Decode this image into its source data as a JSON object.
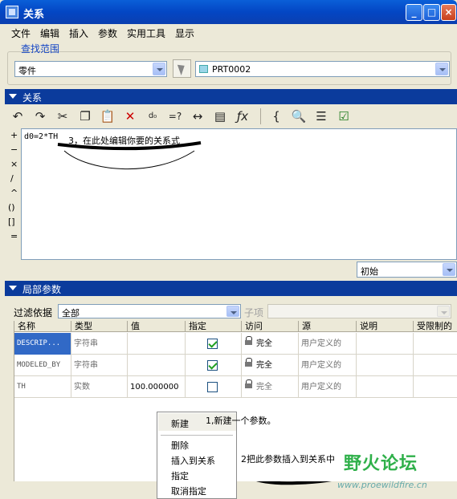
{
  "window": {
    "title": "关系",
    "minimize_glyph": "_",
    "maximize_glyph": "□",
    "close_glyph": "×"
  },
  "menu": [
    "文件",
    "编辑",
    "插入",
    "参数",
    "实用工具",
    "显示"
  ],
  "find_scope": {
    "label": "查找范围",
    "type_value": "零件",
    "model_value": "PRT0002"
  },
  "relations_section": {
    "title": "关系",
    "toolbar_icons": [
      "undo-icon",
      "redo-icon",
      "cut-icon",
      "copy-icon",
      "paste-icon",
      "delete-icon",
      "units-icon",
      "evaluate-icon",
      "measure-icon",
      "parameter-icon",
      "function-icon",
      "brackets-icon",
      "verify-icon",
      "sort-icon",
      "check-icon"
    ],
    "operators": [
      "+",
      "−",
      "×",
      "/",
      "^",
      "()",
      "[]",
      "="
    ],
    "code": "d0=2*TH",
    "annotation": "3，在此处编辑你要的关系式",
    "mode_value": "初始"
  },
  "local_params_section": {
    "title": "局部参数",
    "filter_label": "过滤依据",
    "filter_value": "全部",
    "subitem_label": "子项",
    "columns": [
      "名称",
      "类型",
      "值",
      "指定",
      "访问",
      "源",
      "说明",
      "受限制的"
    ],
    "rows": [
      {
        "name": "DESCRIP...",
        "type": "字符串",
        "value": "",
        "designated": true,
        "access": "完全",
        "source": "用户定义的",
        "selected": true
      },
      {
        "name": "MODELED_BY",
        "type": "字符串",
        "value": "",
        "designated": true,
        "access": "完全",
        "source": "用户定义的",
        "selected": false
      },
      {
        "name": "TH",
        "type": "实数",
        "value": "100.000000",
        "designated": false,
        "access": "完全",
        "source": "用户定义的",
        "selected": false
      }
    ]
  },
  "context_menu": {
    "items": [
      "新建",
      "删除",
      "插入到关系",
      "指定",
      "取消指定"
    ],
    "annotation_new": "1,新建一个参数。",
    "annotation_insert": "2把此参数插入到关系中"
  },
  "watermark": {
    "text": "野火论坛",
    "url": "www.proewildfire.cn"
  }
}
